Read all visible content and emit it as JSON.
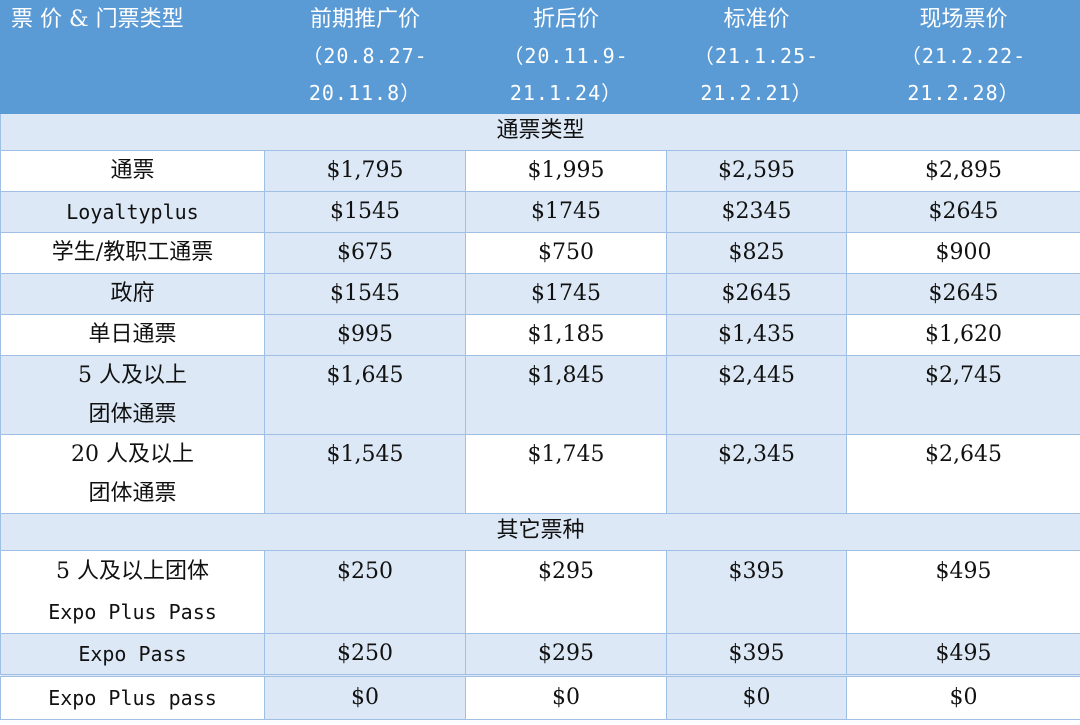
{
  "header": {
    "first": "票 价 & 门票类型",
    "columns": [
      {
        "name": "前期推广价",
        "range_a": "（20.8.27-",
        "range_b": "20.11.8）"
      },
      {
        "name": "折后价",
        "range_a": "（20.11.9-",
        "range_b": "21.1.24）"
      },
      {
        "name": "标准价",
        "range_a": "（21.1.25-",
        "range_b": "21.2.21）"
      },
      {
        "name": "现场票价",
        "range_a": "（21.2.22-",
        "range_b": "21.2.28）"
      }
    ]
  },
  "sections": {
    "pass_types": "通票类型",
    "other_types": "其它票种"
  },
  "rows_a": [
    {
      "label": "通票",
      "values": [
        "$1,795",
        "$1,995",
        "$2,595",
        "$2,895"
      ]
    },
    {
      "label": "Loyaltyplus",
      "values": [
        "$1545",
        "$1745",
        "$2345",
        "$2645"
      ]
    },
    {
      "label": "学生/教职工通票",
      "values": [
        "$675",
        "$750",
        "$825",
        "$900"
      ]
    },
    {
      "label": "政府",
      "values": [
        "$1545",
        "$1745",
        "$2645",
        "$2645"
      ]
    },
    {
      "label": "单日通票",
      "values": [
        "$995",
        "$1,185",
        "$1,435",
        "$1,620"
      ]
    }
  ],
  "rows_b": [
    {
      "label_a": "5 人及以上",
      "label_b": "团体通票",
      "values": [
        "$1,645",
        "$1,845",
        "$2,445",
        "$2,745"
      ]
    },
    {
      "label_a": "20 人及以上",
      "label_b": "团体通票",
      "values": [
        "$1,545",
        "$1,745",
        "$2,345",
        "$2,645"
      ]
    }
  ],
  "rows_c": [
    {
      "label_a": "5 人及以上团体",
      "label_b": "Expo Plus Pass",
      "values": [
        "$250",
        "$295",
        "$395",
        "$495"
      ]
    },
    {
      "label": "Expo Pass",
      "values": [
        "$250",
        "$295",
        "$395",
        "$495"
      ]
    },
    {
      "label": "Expo Plus pass",
      "values": [
        "$0",
        "$0",
        "$0",
        "$0"
      ]
    }
  ]
}
